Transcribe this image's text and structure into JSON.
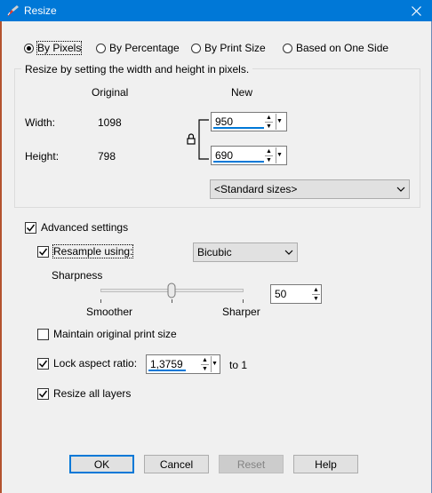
{
  "window": {
    "title": "Resize",
    "icon": "app-brush-icon",
    "close_icon": "close-icon"
  },
  "modes": [
    {
      "label": "By Pixels",
      "selected": true
    },
    {
      "label": "By Percentage",
      "selected": false
    },
    {
      "label": "By Print Size",
      "selected": false
    },
    {
      "label": "Based on One Side",
      "selected": false
    }
  ],
  "pixels_group": {
    "title": "Resize by setting the width and height in pixels.",
    "original_header": "Original",
    "new_header": "New",
    "width_label": "Width:",
    "height_label": "Height:",
    "original_width": "1098",
    "original_height": "798",
    "new_width": "950",
    "new_height": "690",
    "lock_icon": "lock-icon",
    "standard_sizes": "<Standard sizes>"
  },
  "advanced": {
    "label": "Advanced settings",
    "checked": true,
    "resample_label": "Resample using:",
    "resample_checked": true,
    "resample_method": "Bicubic",
    "sharpness_label": "Sharpness",
    "smoother_label": "Smoother",
    "sharper_label": "Sharper",
    "sharpness_value": "50",
    "maintain_print_label": "Maintain original print size",
    "maintain_print_checked": false,
    "lock_aspect_label": "Lock aspect ratio:",
    "lock_aspect_checked": true,
    "aspect_value": "1,3759",
    "aspect_suffix": "to 1",
    "resize_layers_label": "Resize all layers",
    "resize_layers_checked": true
  },
  "buttons": {
    "ok": "OK",
    "cancel": "Cancel",
    "reset": "Reset",
    "help": "Help"
  },
  "colors": {
    "titlebar": "#0078d7",
    "accent": "#0078d7",
    "window_bg": "#f0f0f0"
  }
}
